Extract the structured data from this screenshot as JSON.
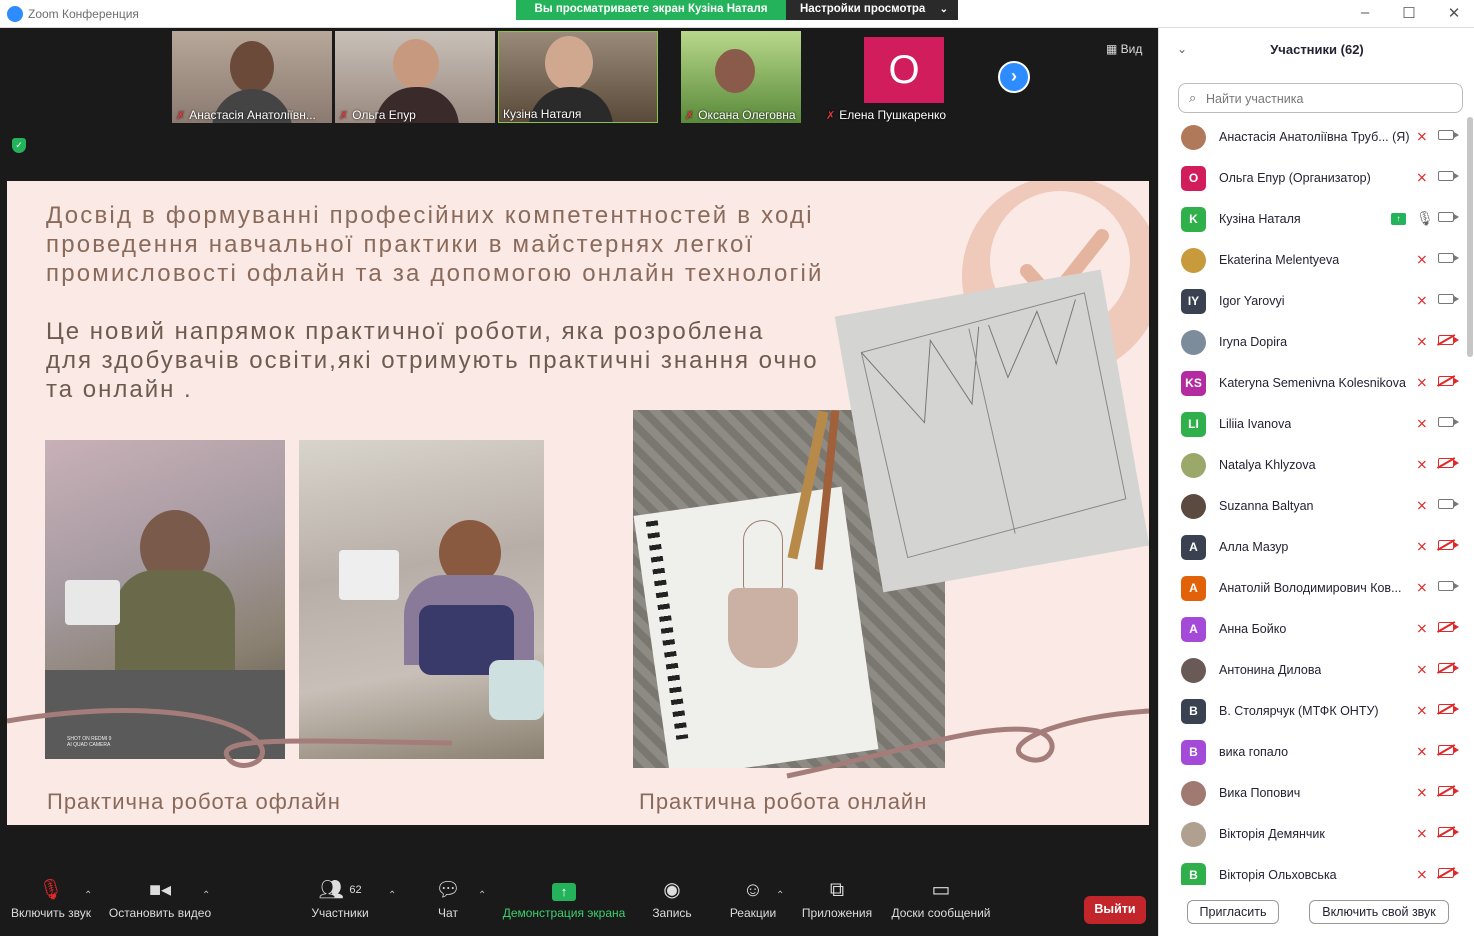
{
  "window": {
    "title": "Zoom Конференция"
  },
  "share_banner": {
    "text": "Вы просматриваете экран Кузіна Наталя",
    "options": "Настройки просмотра"
  },
  "view_button": "Вид",
  "thumbnails": [
    {
      "name": "Анастасія Анатоліївн..."
    },
    {
      "name": "Ольга Епур"
    },
    {
      "name": "Кузіна Наталя"
    },
    {
      "name": "Оксана Олеговна"
    },
    {
      "name": "Елена Пушкаренко",
      "initial": "О"
    }
  ],
  "slide": {
    "title": "Досвід  в формуванні професійних  компетентностей в ході\nпроведення   навчальної практики в майстернях легкої\nпромисловості  офлайн та за   допомогою  онлайн технологій",
    "subtitle": "Це   новий  напрямок  практичної  роботи, яка розроблена\nдля здобувачів освіти,які отримують практичні знання очно\n та онлайн .",
    "caption_offline": "Практична робота офлайн",
    "caption_online": "Практична робота онлайн",
    "photo_watermark": "SHOT ON REDMI 9\nAI QUAD CAMERA"
  },
  "sidebar": {
    "title": "Участники (62)",
    "search_placeholder": "Найти участника",
    "participants": [
      {
        "name": "Анастасія Анатоліївна Труб... (Я)",
        "avatar": "",
        "color": "#b07a5a",
        "mic": "muted",
        "cam": "on"
      },
      {
        "name": "Ольга Епур (Организатор)",
        "avatar": "O",
        "color": "#d11d5b",
        "mic": "muted",
        "cam": "on"
      },
      {
        "name": "Кузіна Наталя",
        "avatar": "K",
        "color": "#2fb04a",
        "mic": "on",
        "cam": "on",
        "sharing": true
      },
      {
        "name": "Ekaterina Melentyeva",
        "avatar": "",
        "color": "#c79a3c",
        "mic": "muted",
        "cam": "on"
      },
      {
        "name": "Igor Yarovyi",
        "avatar": "IY",
        "color": "#3a4150",
        "mic": "muted",
        "cam": "on"
      },
      {
        "name": "Iryna Dopira",
        "avatar": "",
        "color": "#7d8c9a",
        "mic": "muted",
        "cam": "off"
      },
      {
        "name": "Kateryna Semenivna Kolesnikova",
        "avatar": "KS",
        "color": "#b42aa0",
        "mic": "muted",
        "cam": "off"
      },
      {
        "name": "Liliia Ivanova",
        "avatar": "LI",
        "color": "#2fb04a",
        "mic": "muted",
        "cam": "on"
      },
      {
        "name": "Natalya Khlyzova",
        "avatar": "",
        "color": "#9aa86a",
        "mic": "muted",
        "cam": "off"
      },
      {
        "name": "Suzanna Baltyan",
        "avatar": "",
        "color": "#5a4a40",
        "mic": "muted",
        "cam": "on"
      },
      {
        "name": "Алла Мазур",
        "avatar": "A",
        "color": "#3a4150",
        "mic": "muted",
        "cam": "off"
      },
      {
        "name": "Анатолій Володимирович Ков...",
        "avatar": "A",
        "color": "#e2620a",
        "mic": "muted",
        "cam": "on"
      },
      {
        "name": "Анна Бойко",
        "avatar": "A",
        "color": "#a44ad8",
        "mic": "muted",
        "cam": "off"
      },
      {
        "name": "Антонина Дилова",
        "avatar": "",
        "color": "#6a5a55",
        "mic": "muted",
        "cam": "off"
      },
      {
        "name": "В. Столярчук (МТФК ОНТУ)",
        "avatar": "B",
        "color": "#3a4150",
        "mic": "muted",
        "cam": "off"
      },
      {
        "name": "вика гопало",
        "avatar": "B",
        "color": "#a44ad8",
        "mic": "muted",
        "cam": "off"
      },
      {
        "name": "Вика Попович",
        "avatar": "",
        "color": "#a07a70",
        "mic": "muted",
        "cam": "off"
      },
      {
        "name": "Вікторія Демянчик",
        "avatar": "",
        "color": "#b0a090",
        "mic": "muted",
        "cam": "off"
      },
      {
        "name": "Вікторія Ольховська",
        "avatar": "B",
        "color": "#2fb04a",
        "mic": "muted",
        "cam": "off"
      }
    ],
    "invite_button": "Пригласить",
    "unmute_button": "Включить свой звук"
  },
  "toolbar": {
    "unmute": "Включить звук",
    "stop_video": "Остановить видео",
    "participants": "Участники",
    "participants_count": "62",
    "chat": "Чат",
    "share": "Демонстрация экрана",
    "record": "Запись",
    "reactions": "Реакции",
    "apps": "Приложения",
    "whiteboards": "Доски сообщений",
    "leave": "Выйти"
  },
  "colors": {
    "share_green": "#24b35a",
    "leave_red": "#c2262b",
    "zoom_blue": "#2d8cff",
    "slide_bg": "#fbe9e5"
  }
}
